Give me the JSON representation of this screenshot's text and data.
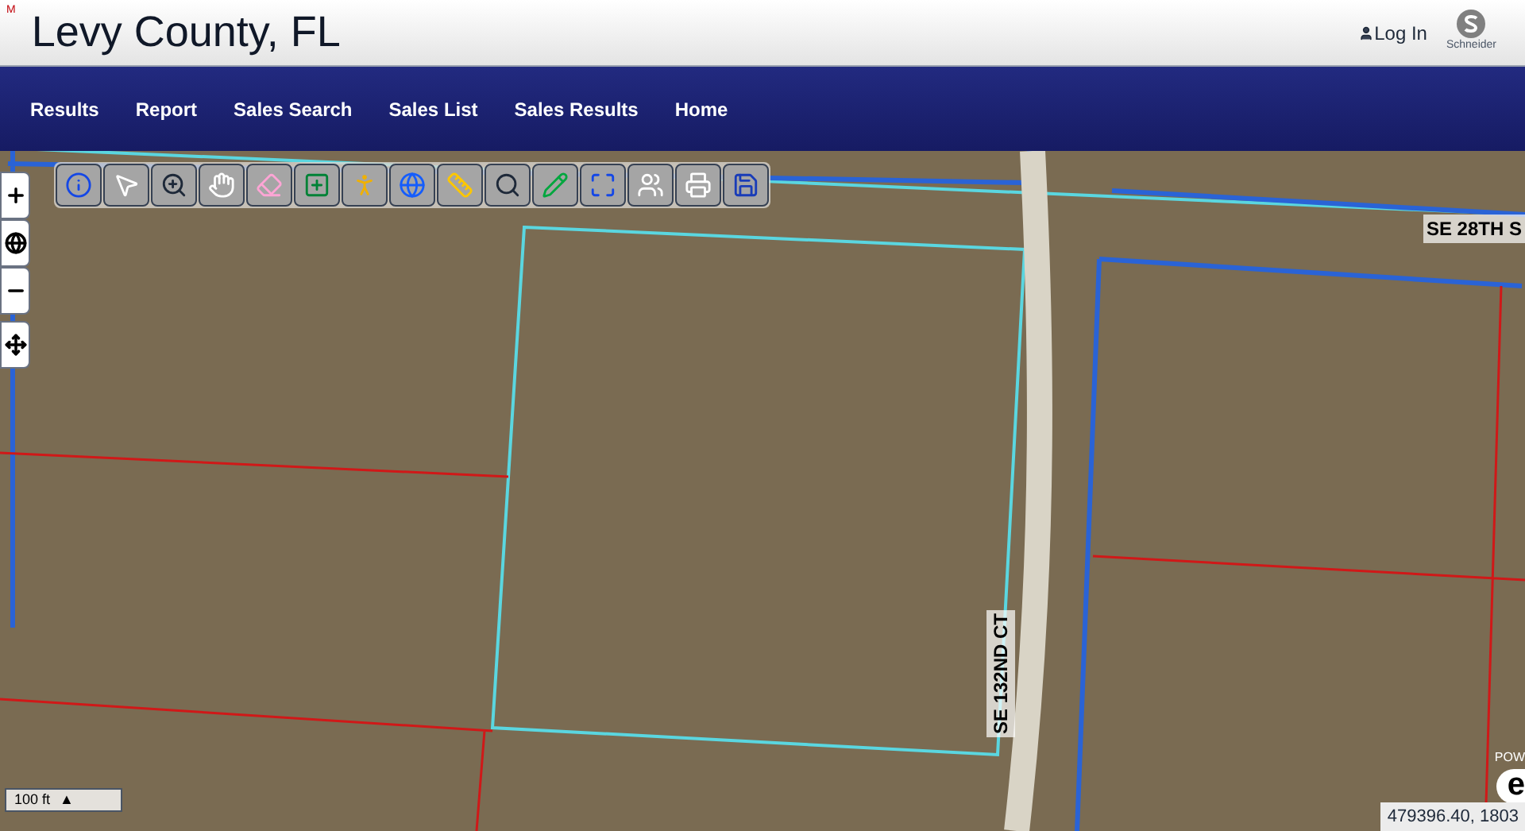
{
  "header": {
    "mark": "M",
    "title": "Levy County, FL",
    "login": "Log In",
    "logo_text": "Schneider"
  },
  "nav": [
    {
      "label": "Results"
    },
    {
      "label": "Report"
    },
    {
      "label": "Sales Search"
    },
    {
      "label": "Sales List"
    },
    {
      "label": "Sales Results"
    },
    {
      "label": "Home"
    }
  ],
  "toolbar": [
    {
      "kind": "info"
    },
    {
      "kind": "select"
    },
    {
      "kind": "zoom-in"
    },
    {
      "kind": "pan"
    },
    {
      "kind": "eraser"
    },
    {
      "kind": "add-area"
    },
    {
      "kind": "person"
    },
    {
      "kind": "globe"
    },
    {
      "kind": "measure"
    },
    {
      "kind": "search"
    },
    {
      "kind": "pencil"
    },
    {
      "kind": "extent"
    },
    {
      "kind": "layers"
    },
    {
      "kind": "print"
    },
    {
      "kind": "save"
    }
  ],
  "zoom_controls": [
    {
      "kind": "zoom-in"
    },
    {
      "kind": "globe"
    },
    {
      "kind": "zoom-out"
    },
    {
      "kind": "pan"
    }
  ],
  "map": {
    "road_labels": [
      {
        "text": "SE 28TH S",
        "kind": "horizontal"
      },
      {
        "text": "SE 132ND CT",
        "kind": "vertical"
      }
    ],
    "scale": "100 ft",
    "scale_arrow": "▲",
    "coordinates": "479396.40, 1803",
    "powered": "POW",
    "powered_logo": "e"
  }
}
